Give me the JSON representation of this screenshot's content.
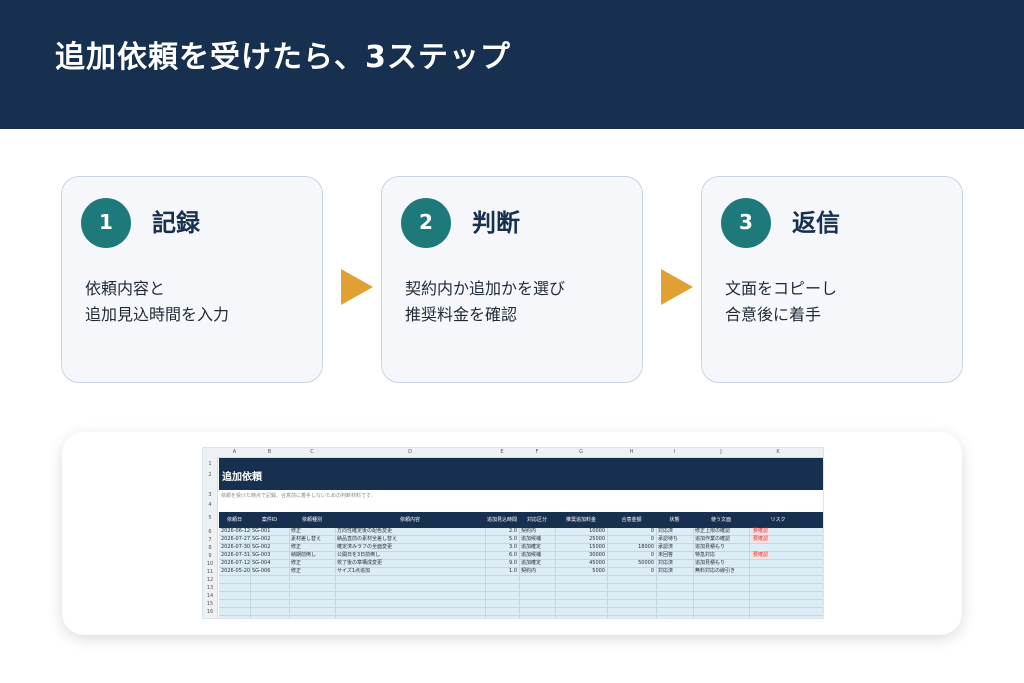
{
  "title": "追加依頼を受けたら、3ステップ",
  "steps": [
    {
      "num": "1",
      "title": "記録",
      "lines": [
        "依頼内容と",
        "追加見込時間を入力"
      ]
    },
    {
      "num": "2",
      "title": "判断",
      "lines": [
        "契約内か追加かを選び",
        "推奨料金を確認"
      ]
    },
    {
      "num": "3",
      "title": "返信",
      "lines": [
        "文面をコピーし",
        "合意後に着手"
      ]
    }
  ],
  "sheet": {
    "columns": [
      "A",
      "B",
      "C",
      "D",
      "E",
      "F",
      "G",
      "H",
      "I",
      "J",
      "K"
    ],
    "row_numbers": [
      "1",
      "2",
      "3",
      "4",
      "5",
      "6",
      "7",
      "8",
      "9",
      "10",
      "11",
      "12",
      "13",
      "14",
      "15",
      "16"
    ],
    "banner": "追加依頼",
    "note": "依頼を受けた時点で記録、合意前に着手しないための判断材料です。",
    "headers": [
      "依頼日",
      "案件ID",
      "依頼種別",
      "依頼内容",
      "追加見込時間",
      "対応区分",
      "推奨追加料金",
      "合意金額",
      "状態",
      "使う文面",
      "リスク"
    ],
    "rows": [
      {
        "date": "2026-06-12",
        "id": "SG-001",
        "kind": "修正",
        "content": "方向性確定後の配色変更",
        "hours": "2.0",
        "cat": "契約内",
        "fee": "10000",
        "agreed": "0",
        "status": "対応済",
        "text": "修正上限の確認",
        "risk": "要確認"
      },
      {
        "date": "2026-07-27",
        "id": "SG-002",
        "kind": "素材差し替え",
        "content": "納品直前の素材全差し替え",
        "hours": "5.0",
        "cat": "追加候補",
        "fee": "25000",
        "agreed": "0",
        "status": "承認待ち",
        "text": "追加作業の確認",
        "risk": "要確認"
      },
      {
        "date": "2026-07-30",
        "id": "SG-002",
        "kind": "修正",
        "content": "確定済みラフの全面変更",
        "hours": "3.0",
        "cat": "追加確定",
        "fee": "15000",
        "agreed": "18000",
        "status": "承認済",
        "text": "追加見積もり",
        "risk": ""
      },
      {
        "date": "2026-07-31",
        "id": "SG-003",
        "kind": "納期前倒し",
        "content": "公開日を3日前倒し",
        "hours": "6.0",
        "cat": "追加候補",
        "fee": "30000",
        "agreed": "0",
        "status": "未回答",
        "text": "特急対応",
        "risk": "要確認"
      },
      {
        "date": "2026-07-12",
        "id": "SG-004",
        "kind": "修正",
        "content": "校了後の章構成変更",
        "hours": "9.0",
        "cat": "追加確定",
        "fee": "45000",
        "agreed": "50000",
        "status": "対応済",
        "text": "追加見積もり",
        "risk": ""
      },
      {
        "date": "2026-05-20",
        "id": "SG-006",
        "kind": "修正",
        "content": "サイズ1点追加",
        "hours": "1.0",
        "cat": "契約内",
        "fee": "5000",
        "agreed": "0",
        "status": "対応済",
        "text": "無料対応の線引き",
        "risk": ""
      }
    ]
  },
  "colors": {
    "navy": "#17304f",
    "teal": "#1e7a7a",
    "arrow": "#e0a032",
    "card_bg": "#f5f7fa"
  }
}
